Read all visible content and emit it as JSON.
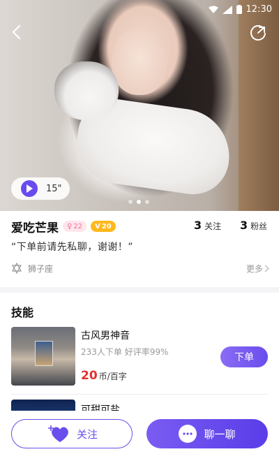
{
  "status_bar": {
    "time": "12:30"
  },
  "hero": {
    "voice_duration": "15\"",
    "carousel_total": 3,
    "carousel_active": 2
  },
  "profile": {
    "name": "爱吃芒果",
    "gender_badge": "22",
    "level_badge": "20",
    "following": {
      "count": "3",
      "label": "关注"
    },
    "fans": {
      "count": "3",
      "label": "粉丝"
    },
    "quote": "“下单前请先私聊，谢谢！”",
    "zodiac": "狮子座",
    "more_label": "更多"
  },
  "skills": {
    "section_title": "技能",
    "items": [
      {
        "name": "古风男神音",
        "stats": "233人下单 好评率99%",
        "price": "20",
        "unit": "币/百字",
        "order_label": "下单"
      },
      {
        "name": "可甜可盐"
      }
    ]
  },
  "actions": {
    "follow_label": "关注",
    "chat_label": "聊一聊"
  },
  "colors": {
    "accent": "#6a4ded",
    "price": "#e53030",
    "level_badge": "#ffb81c",
    "female_badge": "#f0709a"
  }
}
